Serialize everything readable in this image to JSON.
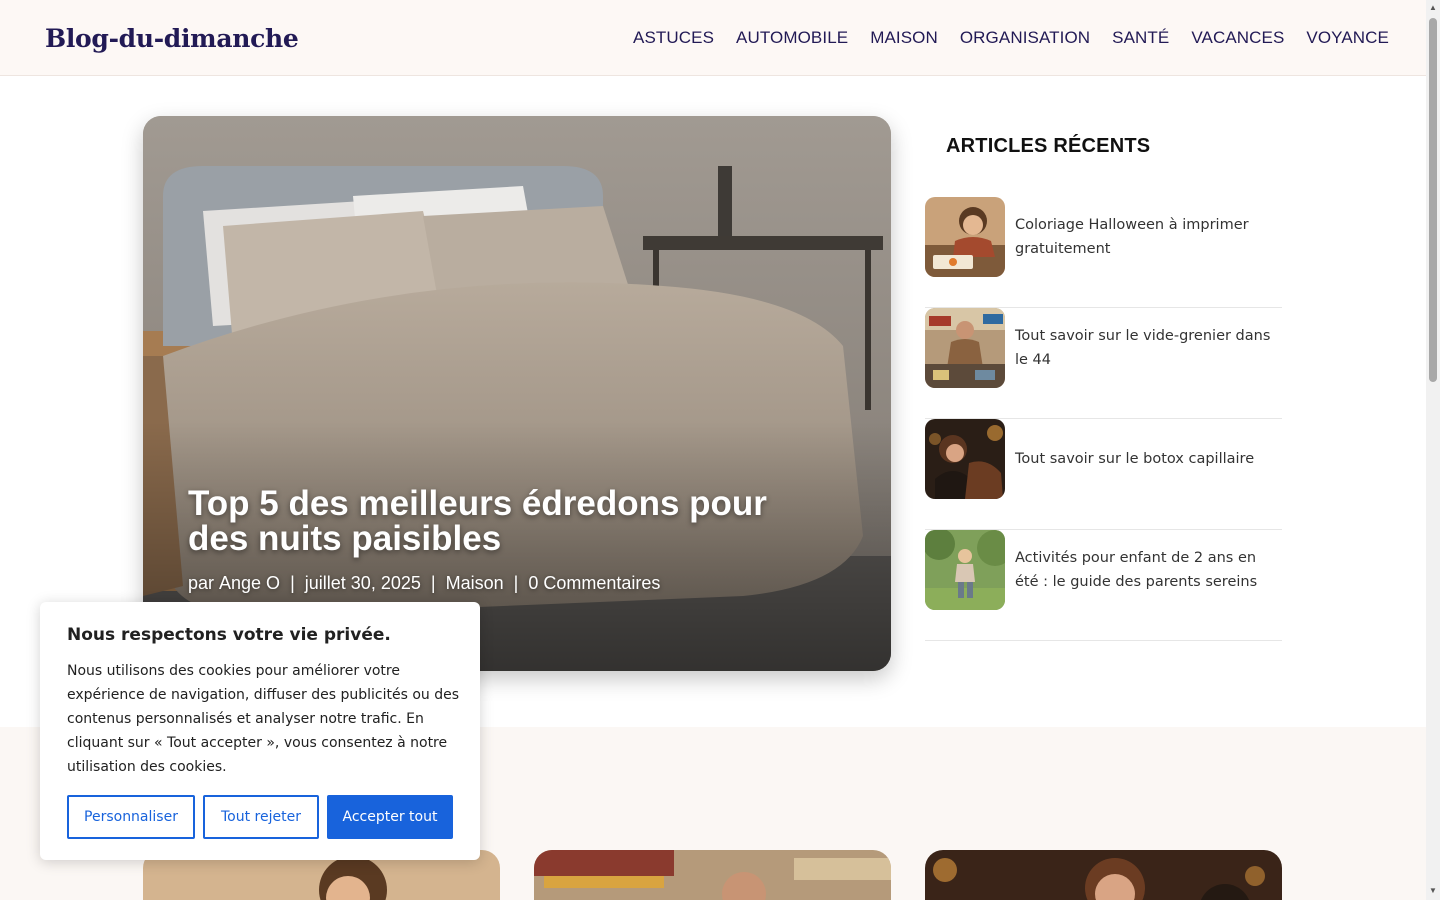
{
  "header": {
    "logo": "Blog-du-dimanche",
    "nav": [
      "ASTUCES",
      "AUTOMOBILE",
      "MAISON",
      "ORGANISATION",
      "SANTÉ",
      "VACANCES",
      "VOYANCE"
    ]
  },
  "hero": {
    "title": "Top 5 des meilleurs édredons pour des nuits paisibles",
    "meta": {
      "prefix": "par",
      "author": "Ange O",
      "sep": "|",
      "date": "juillet 30, 2025",
      "category": "Maison",
      "comments": "0 Commentaires"
    }
  },
  "sidebar": {
    "title": "ARTICLES RÉCENTS",
    "items": [
      {
        "label": "Coloriage Halloween à imprimer gratuitement"
      },
      {
        "label": "Tout savoir sur le vide-grenier dans le 44"
      },
      {
        "label": "Tout savoir sur le botox capillaire"
      },
      {
        "label": "Activités pour enfant de 2 ans en été : le guide des parents sereins"
      }
    ]
  },
  "cookie": {
    "title": "Nous respectons votre vie privée.",
    "text": "Nous utilisons des cookies pour améliorer votre expérience de navigation, diffuser des publicités ou des contenus personnalisés et analyser notre trafic. En cliquant sur « Tout accepter », vous consentez à notre utilisation des cookies.",
    "customize": "Personnaliser",
    "reject": "Tout rejeter",
    "accept": "Accepter tout"
  },
  "colors": {
    "brand": "#221a55",
    "cookie_accent": "#1863dc",
    "header_bg": "#fdf8f5"
  },
  "icons": {
    "scroll_up": "arrow-up-icon",
    "scroll_down": "arrow-down-icon"
  }
}
